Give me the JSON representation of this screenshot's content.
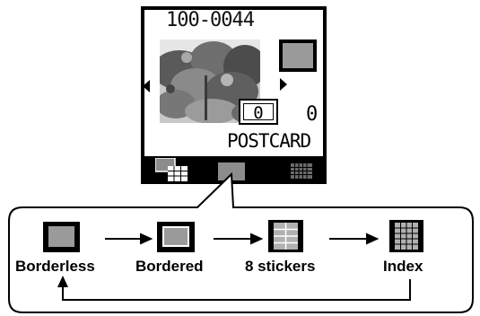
{
  "screen": {
    "file_number": "100-0044",
    "copies": "0",
    "total_prints": "0",
    "paper_size": "POSTCARD"
  },
  "tabs": [
    {
      "icon": "multi-image-icon"
    },
    {
      "icon": "single-image-icon"
    },
    {
      "icon": "grid-index-icon"
    }
  ],
  "layouts": [
    {
      "label": "Borderless",
      "icon": "borderless-icon"
    },
    {
      "label": "Bordered",
      "icon": "bordered-icon"
    },
    {
      "label": "8 stickers",
      "icon": "stickers-icon"
    },
    {
      "label": "Index",
      "icon": "index-icon"
    }
  ],
  "colors": {
    "screen_bg": "#000000",
    "lcd_bg": "#ffffff",
    "thumb_gray": "#9a9a9a"
  }
}
